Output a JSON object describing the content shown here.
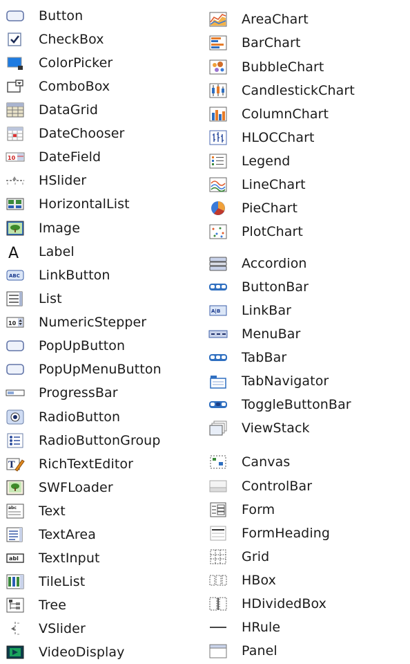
{
  "palette": {
    "left_column": [
      {
        "label": "Button",
        "icon": "button-icon"
      },
      {
        "label": "CheckBox",
        "icon": "checkbox-icon"
      },
      {
        "label": "ColorPicker",
        "icon": "colorpicker-icon"
      },
      {
        "label": "ComboBox",
        "icon": "combobox-icon"
      },
      {
        "label": "DataGrid",
        "icon": "datagrid-icon"
      },
      {
        "label": "DateChooser",
        "icon": "datechooser-icon"
      },
      {
        "label": "DateField",
        "icon": "datefield-icon"
      },
      {
        "label": "HSlider",
        "icon": "hslider-icon"
      },
      {
        "label": "HorizontalList",
        "icon": "horizontallist-icon"
      },
      {
        "label": "Image",
        "icon": "image-icon"
      },
      {
        "label": "Label",
        "icon": "label-icon"
      },
      {
        "label": "LinkButton",
        "icon": "linkbutton-icon"
      },
      {
        "label": "List",
        "icon": "list-icon"
      },
      {
        "label": "NumericStepper",
        "icon": "numericstepper-icon"
      },
      {
        "label": "PopUpButton",
        "icon": "popupbutton-icon"
      },
      {
        "label": "PopUpMenuButton",
        "icon": "popupmenubutton-icon"
      },
      {
        "label": "ProgressBar",
        "icon": "progressbar-icon"
      },
      {
        "label": "RadioButton",
        "icon": "radiobutton-icon"
      },
      {
        "label": "RadioButtonGroup",
        "icon": "radiobuttongroup-icon"
      },
      {
        "label": "RichTextEditor",
        "icon": "richtexteditor-icon"
      },
      {
        "label": "SWFLoader",
        "icon": "swfloader-icon"
      },
      {
        "label": "Text",
        "icon": "text-icon"
      },
      {
        "label": "TextArea",
        "icon": "textarea-icon"
      },
      {
        "label": "TextInput",
        "icon": "textinput-icon"
      },
      {
        "label": "TileList",
        "icon": "tilelist-icon"
      },
      {
        "label": "Tree",
        "icon": "tree-icon"
      },
      {
        "label": "VSlider",
        "icon": "vslider-icon"
      },
      {
        "label": "VideoDisplay",
        "icon": "videodisplay-icon"
      }
    ],
    "right_column": [
      {
        "label": "AreaChart",
        "icon": "areachart-icon"
      },
      {
        "label": "BarChart",
        "icon": "barchart-icon"
      },
      {
        "label": "BubbleChart",
        "icon": "bubblechart-icon"
      },
      {
        "label": "CandlestickChart",
        "icon": "candlestickchart-icon"
      },
      {
        "label": "ColumnChart",
        "icon": "columnchart-icon"
      },
      {
        "label": "HLOCChart",
        "icon": "hlocchart-icon"
      },
      {
        "label": "Legend",
        "icon": "legend-icon"
      },
      {
        "label": "LineChart",
        "icon": "linechart-icon"
      },
      {
        "label": "PieChart",
        "icon": "piechart-icon"
      },
      {
        "label": "PlotChart",
        "icon": "plotchart-icon"
      },
      {
        "label": "Accordion",
        "icon": "accordion-icon"
      },
      {
        "label": "ButtonBar",
        "icon": "buttonbar-icon"
      },
      {
        "label": "LinkBar",
        "icon": "linkbar-icon"
      },
      {
        "label": "MenuBar",
        "icon": "menubar-icon"
      },
      {
        "label": "TabBar",
        "icon": "tabbar-icon"
      },
      {
        "label": "TabNavigator",
        "icon": "tabnavigator-icon"
      },
      {
        "label": "ToggleButtonBar",
        "icon": "togglebuttonbar-icon"
      },
      {
        "label": "ViewStack",
        "icon": "viewstack-icon"
      },
      {
        "label": "Canvas",
        "icon": "canvas-icon"
      },
      {
        "label": "ControlBar",
        "icon": "controlbar-icon"
      },
      {
        "label": "Form",
        "icon": "form-icon"
      },
      {
        "label": "FormHeading",
        "icon": "formheading-icon"
      },
      {
        "label": "Grid",
        "icon": "grid-icon"
      },
      {
        "label": "HBox",
        "icon": "hbox-icon"
      },
      {
        "label": "HDividedBox",
        "icon": "hdividedbox-icon"
      },
      {
        "label": "HRule",
        "icon": "hrule-icon"
      },
      {
        "label": "Panel",
        "icon": "panel-icon"
      }
    ]
  }
}
